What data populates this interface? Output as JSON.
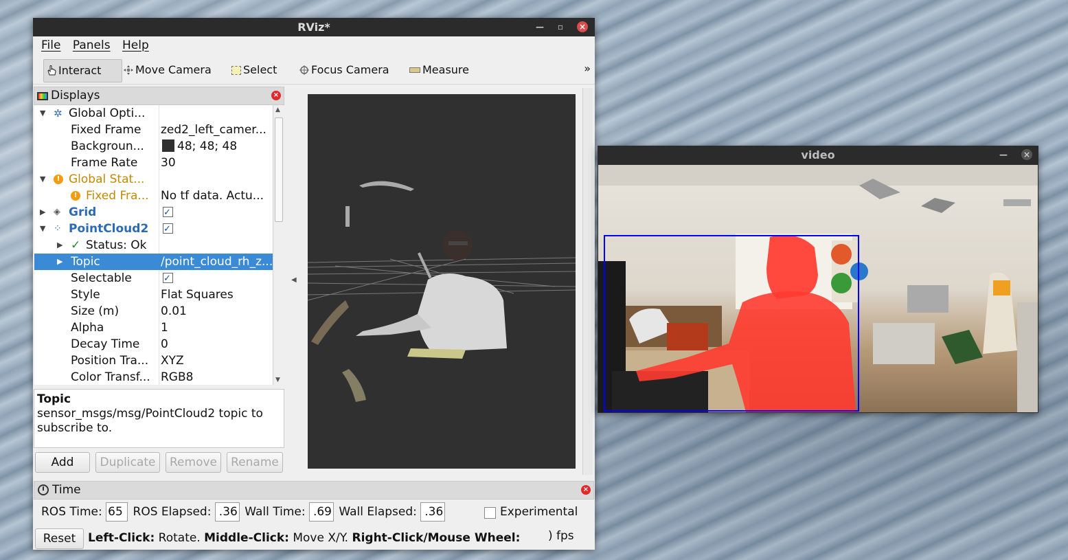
{
  "rviz": {
    "title": "RViz*",
    "menus": [
      "File",
      "Panels",
      "Help"
    ],
    "tools": [
      {
        "label": "Interact",
        "icon": "hand-icon"
      },
      {
        "label": "Move Camera",
        "icon": "move-camera-icon"
      },
      {
        "label": "Select",
        "icon": "select-icon"
      },
      {
        "label": "Focus Camera",
        "icon": "focus-camera-icon"
      },
      {
        "label": "Measure",
        "icon": "measure-icon"
      }
    ],
    "toolbar_more": "»",
    "displays_title": "Displays",
    "tree": {
      "global_options": "Global Opti...",
      "fixed_frame_label": "Fixed Frame",
      "fixed_frame_value": "zed2_left_camer...",
      "background_label": "Backgroun...",
      "background_value": "48; 48; 48",
      "background_color": "#303030",
      "frame_rate_label": "Frame Rate",
      "frame_rate_value": "30",
      "global_status": "Global Stat...",
      "fixed_frame_status": "Fixed Fra...",
      "fixed_frame_status_value": "No tf data.  Actu...",
      "grid": "Grid",
      "pointcloud": "PointCloud2",
      "status_ok": "Status: Ok",
      "topic_label": "Topic",
      "topic_value": "/point_cloud_rh_z...",
      "selectable_label": "Selectable",
      "style_label": "Style",
      "style_value": "Flat Squares",
      "size_label": "Size (m)",
      "size_value": "0.01",
      "alpha_label": "Alpha",
      "alpha_value": "1",
      "decay_label": "Decay Time",
      "decay_value": "0",
      "position_label": "Position Tra...",
      "position_value": "XYZ",
      "color_label": "Color Transf...",
      "color_value": "RGB8"
    },
    "description": {
      "heading": "Topic",
      "body": "sensor_msgs/msg/PointCloud2 topic to subscribe to."
    },
    "buttons": {
      "add": "Add",
      "duplicate": "Duplicate",
      "remove": "Remove",
      "rename": "Rename"
    },
    "time_panel": {
      "title": "Time",
      "ros_time_label": "ROS Time:",
      "ros_time_value": "65",
      "ros_elapsed_label": "ROS Elapsed:",
      "ros_elapsed_value": ".36",
      "wall_time_label": "Wall Time:",
      "wall_time_value": ".69",
      "wall_elapsed_label": "Wall Elapsed:",
      "wall_elapsed_value": ".36",
      "experimental_label": "Experimental",
      "reset_label": "Reset",
      "status_left_click": "Left-Click:",
      "status_rotate": " Rotate. ",
      "status_middle_click": "Middle-Click:",
      "status_move": " Move X/Y. ",
      "status_right_click": "Right-Click/Mouse Wheel:",
      "status_fps": ") fps"
    }
  },
  "video": {
    "title": "video",
    "box_color": "#0000ff",
    "mask_color": "#ff3b30"
  }
}
